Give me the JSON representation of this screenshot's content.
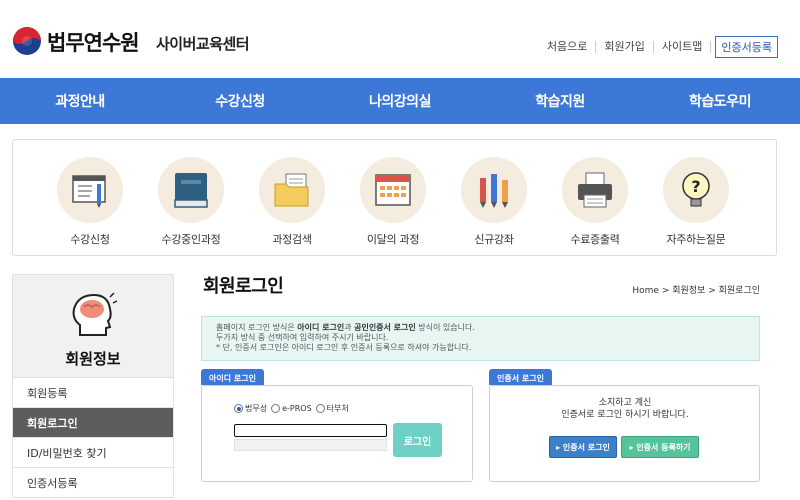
{
  "header": {
    "logo_main": "법무연수원",
    "logo_sub": "사이버교육센터",
    "links": [
      "처음으로",
      "회원가입",
      "사이트맵"
    ],
    "cert_button": "인증서등록"
  },
  "gnb": [
    "과정안내",
    "수강신청",
    "나의강의실",
    "학습지원",
    "학습도우미"
  ],
  "quick_menu": [
    {
      "label": "수강신청",
      "icon": "registration-form-icon"
    },
    {
      "label": "수강중인과정",
      "icon": "book-icon"
    },
    {
      "label": "과정검색",
      "icon": "folder-icon"
    },
    {
      "label": "이달의 과정",
      "icon": "calendar-icon"
    },
    {
      "label": "신규강좌",
      "icon": "pencils-icon"
    },
    {
      "label": "수료증출력",
      "icon": "printer-icon"
    },
    {
      "label": "자주하는질문",
      "icon": "lightbulb-question-icon"
    }
  ],
  "sidebar": {
    "title": "회원정보",
    "items": [
      "회원등록",
      "회원로그인",
      "ID/비밀번호 찾기",
      "인증서등록"
    ],
    "active_index": 1
  },
  "content": {
    "title": "회원로그인",
    "breadcrumb": "Home > 회원정보 > 회원로그인",
    "notice": {
      "line1_pre": "홈페이지 로그인 방식은 ",
      "line1_b1": "아이디 로그인",
      "line1_mid": "과 ",
      "line1_b2": "공인인증서 로그인",
      "line1_post": " 방식이 있습니다.",
      "line2": "두가지 방식 중 선택하여 입력하여 주시기 바랍니다.",
      "line3": "* 단, 인증서 로그인은 아이디 로그인 후 인증서 등록으로 하셔야 가능합니다."
    },
    "id_login": {
      "tab": "아이디 로그인",
      "options": [
        "법무성",
        "e-PROS",
        "타부처"
      ],
      "selected_option": 0,
      "id_value": "",
      "pw_value": "",
      "button": "로그인"
    },
    "cert_login": {
      "tab": "인증서 로그인",
      "message_line1": "소지하고 계신",
      "message_line2": "인증서로 로그인 하시기 바랍니다.",
      "login_button": "▸ 인증서 로그인",
      "register_button": "▸ 인증서 등록하기"
    }
  },
  "colors": {
    "gnb": "#3b78d8",
    "login_button": "#6fd0c6",
    "cert_login_button": "#3d7fc9",
    "cert_register_button": "#57c39a",
    "sidebar_active": "#5d5d5d"
  }
}
